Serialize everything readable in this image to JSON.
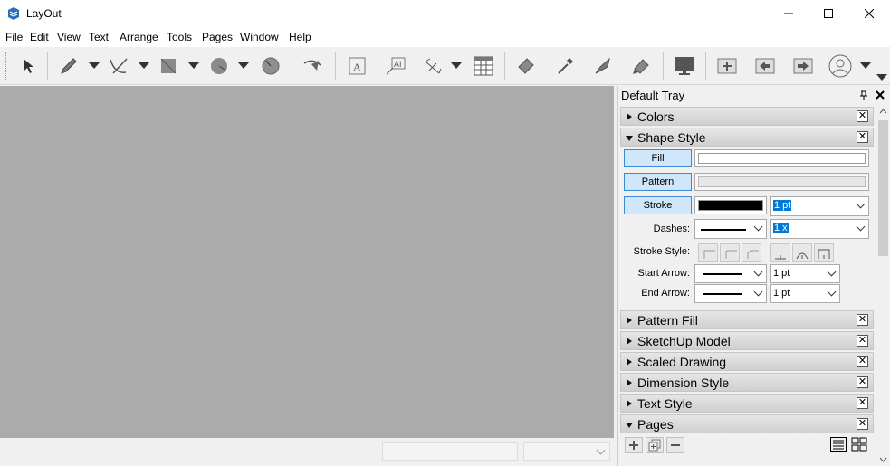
{
  "window": {
    "title": "LayOut"
  },
  "menu": [
    "File",
    "Edit",
    "View",
    "Text",
    "Arrange",
    "Tools",
    "Pages",
    "Window",
    "Help"
  ],
  "toolbar": {
    "tools": [
      "select-tool",
      "pencil-tool",
      "arc-tool",
      "rectangle-tool",
      "circle-tool",
      "polygon-tool",
      "erase-tool",
      "text-tool",
      "label-tool",
      "dimension-tool",
      "table-tool",
      "style-tool",
      "sample-tool",
      "split-tool",
      "join-tool",
      "presentation-tool",
      "add-page-tool",
      "previous-page-tool",
      "next-page-tool",
      "account-tool"
    ]
  },
  "tray": {
    "title": "Default Tray",
    "panels": {
      "colors": "Colors",
      "shape_style": "Shape Style",
      "pattern_fill": "Pattern Fill",
      "sketchup_model": "SketchUp Model",
      "scaled_drawing": "Scaled Drawing",
      "dimension_style": "Dimension Style",
      "text_style": "Text Style",
      "pages": "Pages"
    },
    "shape_style": {
      "fill_label": "Fill",
      "pattern_label": "Pattern",
      "stroke_label": "Stroke",
      "stroke_width": "1 pt",
      "dashes_label": "Dashes:",
      "dash_scale": "1 x",
      "stroke_style_label": "Stroke Style:",
      "start_arrow_label": "Start Arrow:",
      "start_arrow_size": "1 pt",
      "end_arrow_label": "End Arrow:",
      "end_arrow_size": "1 pt",
      "stroke_color": "#000000"
    },
    "close_glyph": "✕"
  }
}
